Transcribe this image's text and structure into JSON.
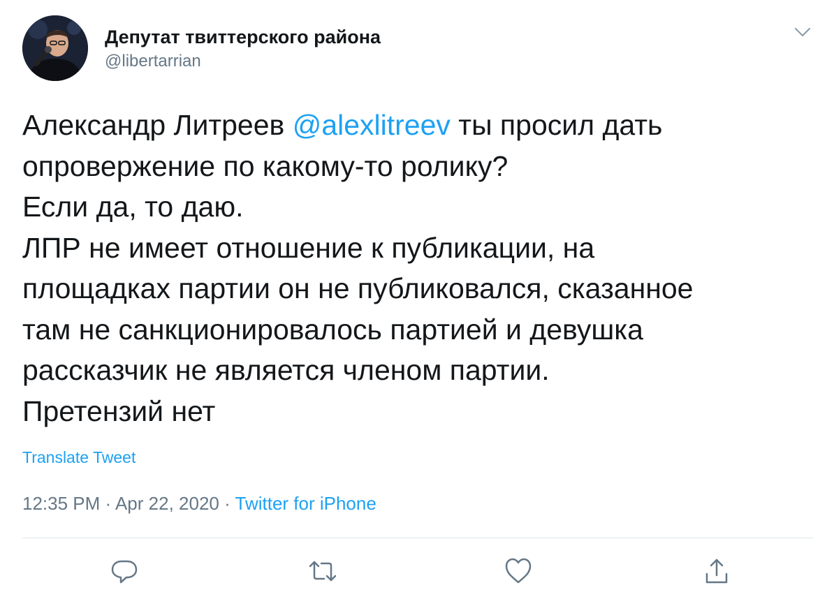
{
  "author": {
    "display_name": "Депутат твиттерского района",
    "handle": "@libertarrian",
    "avatar_icon": "avatar-photo"
  },
  "menu": {
    "icon": "chevron-down-icon"
  },
  "tweet": {
    "text_before_mention": "Александр Литреев ",
    "mention": "@alexlitreev",
    "text_after_mention": " ты просил дать\nопровержение по какому-то ролику?\nЕсли да, то даю.\nЛПР не имеет отношение к  публикации, на\nплощадках партии он не публиковался, сказанное\nтам не санкционировалось партией и девушка\nрассказчик не является членом партии.\nПретензий нет",
    "translate_label": "Translate Tweet",
    "time": "12:35 PM",
    "separator1": " · ",
    "date": "Apr 22, 2020",
    "separator2": " · ",
    "source": "Twitter for iPhone"
  },
  "actions": {
    "reply_icon": "reply-icon",
    "retweet_icon": "retweet-icon",
    "like_icon": "heart-icon",
    "share_icon": "share-icon"
  },
  "colors": {
    "accent": "#1da1f2",
    "text": "#14171a",
    "muted": "#657786",
    "divider": "#e1e8ed"
  }
}
